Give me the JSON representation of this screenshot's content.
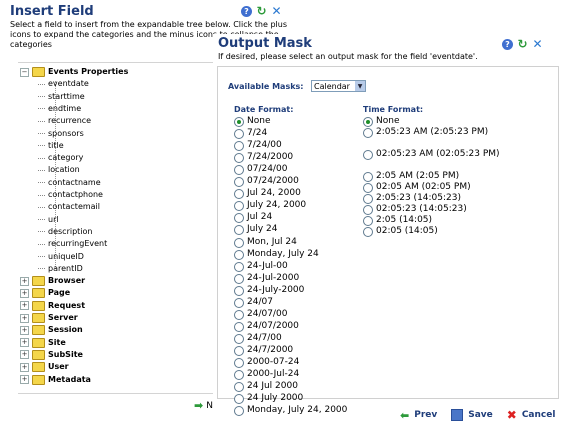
{
  "insert_field": {
    "title": "Insert Field",
    "description": "Select a field to insert from the expandable tree below. Click the plus icons to expand the categories and the minus icons to collapse the categories",
    "tree": {
      "expanded": {
        "label": "Events Properties",
        "toggle": "−"
      },
      "fields": [
        "eventdate",
        "starttime",
        "endtime",
        "recurrence",
        "sponsors",
        "title",
        "category",
        "location",
        "contactname",
        "contactphone",
        "contactemail",
        "url",
        "description",
        "recurringEvent",
        "uniqueID",
        "parentID"
      ],
      "collapsed": [
        {
          "label": "Browser",
          "toggle": "+"
        },
        {
          "label": "Page",
          "toggle": "+"
        },
        {
          "label": "Request",
          "toggle": "+"
        },
        {
          "label": "Server",
          "toggle": "+"
        },
        {
          "label": "Session",
          "toggle": "+"
        },
        {
          "label": "Site",
          "toggle": "+"
        },
        {
          "label": "SubSite",
          "toggle": "+"
        },
        {
          "label": "User",
          "toggle": "+"
        },
        {
          "label": "Metadata",
          "toggle": "+"
        }
      ]
    },
    "next_label": "N"
  },
  "icons": {
    "help": "?",
    "refresh": "↻",
    "close": "✕"
  },
  "output_mask": {
    "title": "Output Mask",
    "description": "If desired, please select an output mask for the field 'eventdate'.",
    "available_masks_label": "Available Masks:",
    "available_masks_value": "Calendar",
    "date_format_label": "Date Format:",
    "date_options": [
      "None",
      "7/24",
      "7/24/00",
      "7/24/2000",
      "07/24/00",
      "07/24/2000",
      "Jul 24, 2000",
      "July 24, 2000",
      "Jul 24",
      "July 24",
      "Mon, Jul 24",
      "Monday, July 24",
      "24-Jul-00",
      "24-Jul-2000",
      "24-July-2000",
      "24/07",
      "24/07/00",
      "24/07/2000",
      "24/7/00",
      "24/7/2000",
      "2000-07-24",
      "2000-Jul-24",
      "24 Jul 2000",
      "24 July 2000",
      "Monday, July 24, 2000"
    ],
    "date_selected": 0,
    "time_format_label": "Time Format:",
    "time_options": [
      "None",
      "2:05:23 AM (2:05:23 PM)",
      "02:05:23 AM (02:05:23 PM)",
      "2:05 AM (2:05 PM)",
      "02:05 AM (02:05 PM)",
      "2:05:23 (14:05:23)",
      "02:05:23 (14:05:23)",
      "2:05 (14:05)",
      "02:05 (14:05)"
    ],
    "time_selected": 0,
    "buttons": {
      "prev": "Prev",
      "save": "Save",
      "cancel": "Cancel"
    }
  },
  "colors": {
    "heading": "#1f3d7a",
    "radio_selected": "#1e8f2a",
    "folder": "#f4d64a"
  }
}
